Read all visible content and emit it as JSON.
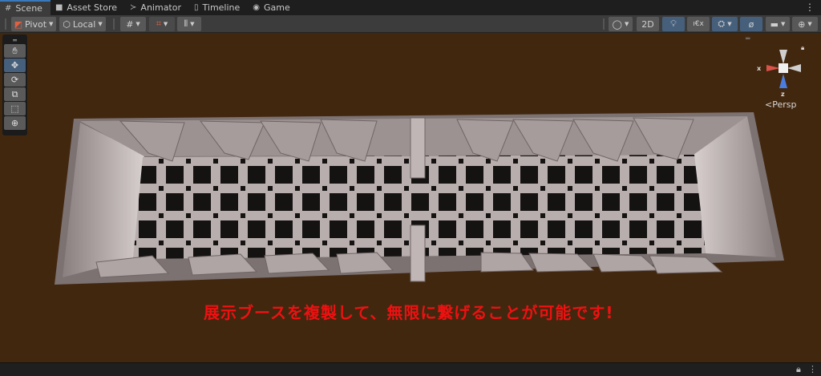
{
  "tabs": [
    {
      "label": "Scene",
      "icon": "grid-icon",
      "active": true
    },
    {
      "label": "Asset Store",
      "icon": "bag-icon"
    },
    {
      "label": "Animator",
      "icon": "animator-icon"
    },
    {
      "label": "Timeline",
      "icon": "timeline-icon"
    },
    {
      "label": "Game",
      "icon": "gamepad-icon"
    }
  ],
  "toolbar": {
    "pivot_label": "Pivot",
    "local_label": "Local",
    "mode_2d_label": "2D"
  },
  "gizmo": {
    "x_label": "x",
    "z_label": "z",
    "projection_label": "Persp"
  },
  "caption": "展示ブースを複製して、無限に繋げることが可能です!",
  "colors": {
    "scene_bg": "#42270f",
    "caption": "#ee1111",
    "active_button": "#46607c",
    "x_axis": "#d9534a",
    "z_axis": "#4a7de0"
  }
}
